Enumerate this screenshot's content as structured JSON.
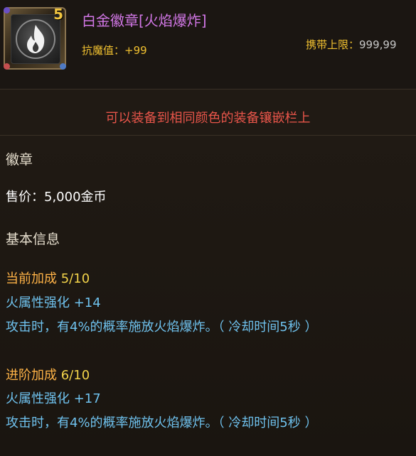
{
  "item": {
    "name": "白金徽章[火焰爆炸]",
    "level_badge": "5",
    "icon": "fire-flame-icon",
    "stat_label": "抗魔值：",
    "stat_value": "+99",
    "carry_limit_label": "携带上限：",
    "carry_limit_value": "999,99"
  },
  "notice": "可以装备到相同颜色的装备镶嵌栏上",
  "category": "徽章",
  "price": "售价：5,000金币",
  "section_title": "基本信息",
  "current": {
    "label": "当前加成 ",
    "value": "5/10",
    "attr": "火属性强化 +14",
    "desc": "攻击时，有4%的概率施放火焰爆炸。（ 冷却时间5秒 ）"
  },
  "next": {
    "label": "进阶加成 ",
    "value": "6/10",
    "attr": "火属性强化 +17",
    "desc": "攻击时，有4%的概率施放火焰爆炸。（ 冷却时间5秒 ）"
  },
  "colors": {
    "title": "#d277e6",
    "notice": "#e8554a",
    "gold": "#f0c030",
    "attribute": "#6fc2ee"
  }
}
